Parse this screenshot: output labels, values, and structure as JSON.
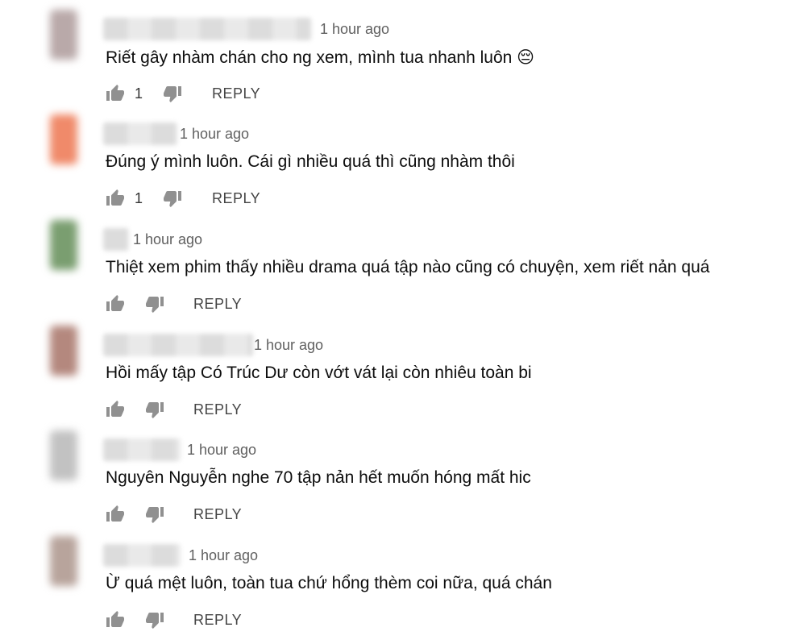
{
  "comments": [
    {
      "time": "1 hour ago",
      "text": "Riết gây nhàm chán cho ng xem, mình tua nhanh luôn 😔",
      "likes": "1",
      "reply_label": "REPLY",
      "avatar_color": "#b9a9a9"
    },
    {
      "time": "1 hour ago",
      "text": "Đúng ý mình luôn. Cái gì nhiều quá thì cũng nhàm thôi",
      "likes": "1",
      "reply_label": "REPLY",
      "avatar_color": "#f08a6a"
    },
    {
      "time": "1 hour ago",
      "text": "Thiệt xem phim thấy nhiều drama quá tập nào cũng có chuyện, xem riết nản quá",
      "likes": "",
      "reply_label": "REPLY",
      "avatar_color": "#7a9e70"
    },
    {
      "time": "1 hour ago",
      "text": "Hồi mấy tập Có Trúc Dư còn vớt vát lại còn nhiêu toàn bi",
      "likes": "",
      "reply_label": "REPLY",
      "avatar_color": "#b4887e"
    },
    {
      "time": "1 hour ago",
      "text": "Nguyên Nguyễn nghe 70 tập nản hết muốn hóng mất hic",
      "likes": "",
      "reply_label": "REPLY",
      "avatar_color": "#c2c2c2"
    },
    {
      "time": "1 hour ago",
      "text": "Ừ quá mệt luôn, toàn tua chứ hổng thèm coi nữa, quá chán",
      "likes": "",
      "reply_label": "REPLY",
      "avatar_color": "#b8a49c"
    }
  ]
}
